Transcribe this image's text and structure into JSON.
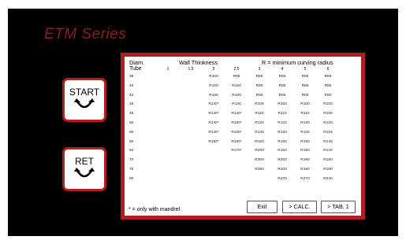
{
  "title": "ETM Series",
  "side_buttons": {
    "start_label": "START",
    "ret_label": "RET"
  },
  "table": {
    "header": {
      "diam": "Diam.",
      "wall": "Wall Thinkness",
      "radius_note": "R = minimum curving radius",
      "tube": "Tube",
      "columns": [
        "1",
        "1.5",
        "2",
        "2.5",
        "3",
        "4",
        "5",
        "6"
      ]
    },
    "rows": [
      {
        "diam": "38",
        "values": [
          "",
          "",
          "R100",
          "R95",
          "R85",
          "R85",
          "R85",
          "R85"
        ]
      },
      {
        "diam": "40",
        "values": [
          "",
          "",
          "R100",
          "R100",
          "R95",
          "R85",
          "R85",
          "R85"
        ]
      },
      {
        "diam": "42",
        "values": [
          "",
          "",
          "R105",
          "R100",
          "R95",
          "R95",
          "R90",
          "R90"
        ]
      },
      {
        "diam": "45",
        "values": [
          "",
          "",
          "R140*",
          "R130",
          "R105",
          "R100",
          "R100",
          "R100"
        ]
      },
      {
        "diam": "48",
        "values": [
          "",
          "",
          "R140*",
          "R140*",
          "R110",
          "R110",
          "R110",
          "R105"
        ]
      },
      {
        "diam": "50",
        "values": [
          "",
          "",
          "R140*",
          "R150*",
          "R120",
          "R120",
          "R120",
          "R120"
        ]
      },
      {
        "diam": "55",
        "values": [
          "",
          "",
          "R140*",
          "R160*",
          "R135",
          "R130",
          "R125",
          "R125"
        ]
      },
      {
        "diam": "60",
        "values": [
          "",
          "",
          "R150*",
          "R160*",
          "R150",
          "R150",
          "R150",
          "R145"
        ]
      },
      {
        "diam": "64",
        "values": [
          "",
          "",
          "",
          "R170*",
          "R200",
          "R150",
          "R150",
          "R140"
        ]
      },
      {
        "diam": "70",
        "values": [
          "",
          "",
          "",
          "",
          "R300",
          "R200",
          "R180",
          "R150"
        ]
      },
      {
        "diam": "76",
        "values": [
          "",
          "",
          "",
          "",
          "R350",
          "R200",
          "R180",
          "R180"
        ]
      },
      {
        "diam": "80",
        "values": [
          "",
          "",
          "",
          "",
          "",
          "R270",
          "R270",
          "R240"
        ]
      }
    ],
    "footnote": "* = only with mandrel"
  },
  "buttons": {
    "exit": "Exit",
    "calc": "> CALC.",
    "tab1": "> TAB. 1"
  },
  "colors": {
    "background": "#000000",
    "accent": "#b31e1e",
    "title": "#8e1c1c"
  }
}
